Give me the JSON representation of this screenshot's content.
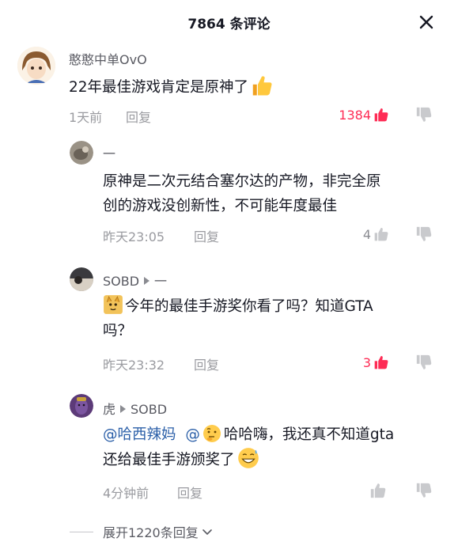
{
  "header": {
    "title": "7864 条评论"
  },
  "comments": [
    {
      "name": "憨憨中单OvO",
      "text": "22年最佳游戏肯定是原神了",
      "time": "1天前",
      "reply_label": "回复",
      "likes": "1384"
    },
    {
      "name": "一",
      "text_line1": "原神是二次元结合塞尔达的产物，非完全原",
      "text_line2": "创的游戏没创新性，不可能年度最佳",
      "time": "昨天23:05",
      "reply_label": "回复",
      "likes": "4"
    },
    {
      "name": "SOBD",
      "reply_to": "一",
      "text_line1": "今年的最佳手游奖你看了吗？知道GTA",
      "text_line2": "吗？",
      "time": "昨天23:32",
      "reply_label": "回复",
      "likes": "3"
    },
    {
      "name": "虎",
      "reply_to": "SOBD",
      "mention1": "@哈西辣妈",
      "mention2": "@",
      "text_line1": "哈哈嗨，我还真不知道gta",
      "text_line2": "还给最佳手游颁奖了",
      "time": "4分钟前",
      "reply_label": "回复"
    }
  ],
  "expand": {
    "label": "展开1220条回复"
  },
  "colors": {
    "like_red": "#fe2c55",
    "mention_blue": "#2b5fa8",
    "meta_gray": "#9a9ba0"
  },
  "icons": [
    "close-icon",
    "thumbs-up-icon",
    "like-icon",
    "dislike-icon",
    "chevron-down-icon",
    "reply-arrow-icon"
  ]
}
